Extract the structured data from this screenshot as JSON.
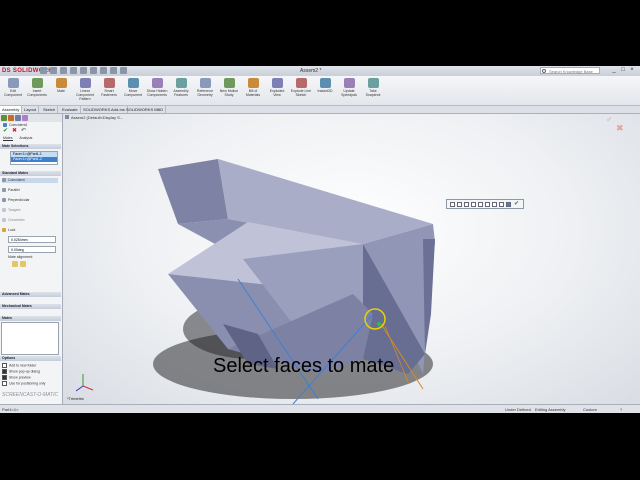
{
  "app": {
    "logo": "DS SOLIDWORKS",
    "document_title": "Assem2 *"
  },
  "search": {
    "placeholder": "Search Knowledge Base"
  },
  "window_controls": [
    "_",
    "□",
    "×"
  ],
  "ribbon": [
    {
      "label": "Edit Component",
      "icon": "edit-component-icon"
    },
    {
      "label": "Insert Components",
      "icon": "insert-components-icon"
    },
    {
      "label": "Mate",
      "icon": "mate-icon"
    },
    {
      "label": "Linear Component Pattern",
      "icon": "linear-pattern-icon"
    },
    {
      "label": "Smart Fasteners",
      "icon": "smart-fasteners-icon"
    },
    {
      "label": "Move Component",
      "icon": "move-component-icon"
    },
    {
      "label": "Show Hidden Components",
      "icon": "show-hidden-icon"
    },
    {
      "label": "Assembly Features",
      "icon": "assembly-features-icon"
    },
    {
      "label": "Reference Geometry",
      "icon": "reference-geometry-icon"
    },
    {
      "label": "New Motion Study",
      "icon": "motion-study-icon"
    },
    {
      "label": "Bill of Materials",
      "icon": "bom-icon"
    },
    {
      "label": "Exploded View",
      "icon": "exploded-view-icon"
    },
    {
      "label": "Explode Line Sketch",
      "icon": "explode-line-icon"
    },
    {
      "label": "Instant3D",
      "icon": "instant3d-icon"
    },
    {
      "label": "Update Speedpak",
      "icon": "speedpak-icon"
    },
    {
      "label": "Take Snapshot",
      "icon": "snapshot-icon"
    }
  ],
  "tabs": [
    "Assembly",
    "Layout",
    "Sketch",
    "Evaluate",
    "SOLIDWORKS Add-Ins",
    "SOLIDWORKS MBD"
  ],
  "panel": {
    "title": "Coincident1",
    "subtabs": [
      "Mates",
      "Analysis"
    ],
    "mate_selections_header": "Mate Selections",
    "selections": [
      "Face<1>@Part1-1",
      "Face<1>@Part1-2"
    ],
    "standard_mates_header": "Standard Mates",
    "standard_mates": [
      "Coincident",
      "Parallel",
      "Perpendicular",
      "Tangent",
      "Concentric",
      "Lock"
    ],
    "distance_value": "0.0254mm",
    "angle_value": "0.00deg",
    "mate_alignment_label": "Mate alignment:",
    "advanced_header": "Advanced Mates",
    "mechanical_header": "Mechanical Mates",
    "mates_header": "Mates",
    "options_header": "Options",
    "options": [
      {
        "label": "Add to new folder",
        "checked": false
      },
      {
        "label": "Show pop-up dialog",
        "checked": true
      },
      {
        "label": "Show preview",
        "checked": true
      },
      {
        "label": "Use for positioning only",
        "checked": false
      }
    ]
  },
  "viewport": {
    "tree_label": "Assem2 (Default<Display S...",
    "caption": "Select faces to mate",
    "view_label": "*Trimetric"
  },
  "status": {
    "left": "Part1<1>",
    "under_defined": "Under Defined",
    "editing": "Editing Assembly",
    "units": "Custom"
  },
  "watermark": "SCREENCAST-O-MATIC",
  "colors": {
    "part_face": "#8e93b3",
    "part_dark": "#5f6486",
    "edge_blue": "#3f7fd0",
    "edge_orange": "#d48a2a",
    "highlight": "#e6d200",
    "accent_red": "#c8102e"
  }
}
